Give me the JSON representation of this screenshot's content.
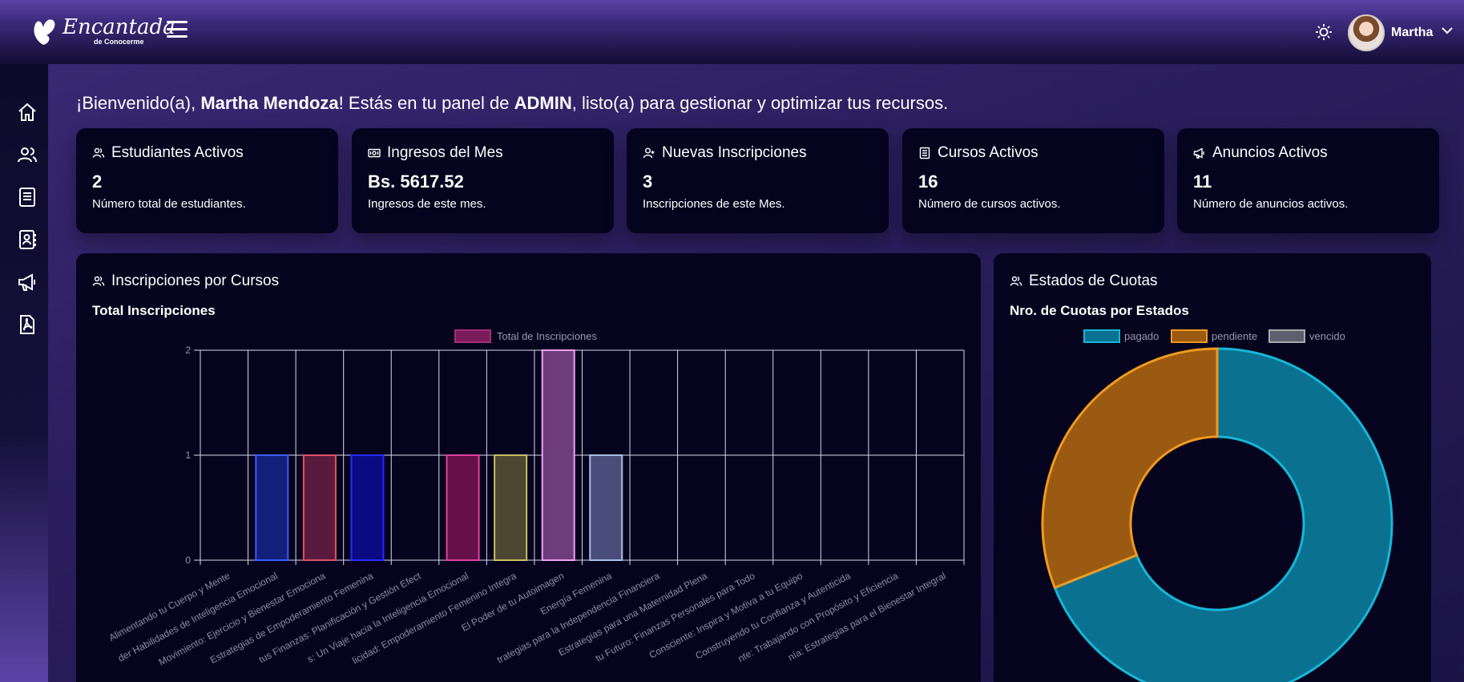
{
  "brand": {
    "name": "Encantada",
    "tagline": "de Conocerme"
  },
  "topbar": {
    "user_name": "Martha"
  },
  "sidebar": {
    "items": [
      {
        "icon": "home-icon"
      },
      {
        "icon": "users-icon"
      },
      {
        "icon": "book-icon"
      },
      {
        "icon": "contacts-icon"
      },
      {
        "icon": "megaphone-icon"
      },
      {
        "icon": "pdf-icon"
      }
    ]
  },
  "welcome": {
    "prefix": "¡Bienvenido(a), ",
    "name": "Martha Mendoza",
    "middle": "! Estás en tu panel de ",
    "role": "ADMIN",
    "suffix": ", listo(a) para gestionar y optimizar tus recursos."
  },
  "cards": [
    {
      "title": "Estudiantes Activos",
      "value": "2",
      "desc": "Número total de estudiantes.",
      "icon": "users-icon"
    },
    {
      "title": "Ingresos del Mes",
      "value": "Bs. 5617.52",
      "desc": "Ingresos de este mes.",
      "icon": "money-icon"
    },
    {
      "title": "Nuevas Inscripciones",
      "value": "3",
      "desc": "Inscripciones de este Mes.",
      "icon": "user-plus-icon"
    },
    {
      "title": "Cursos Activos",
      "value": "16",
      "desc": "Número de cursos activos.",
      "icon": "book-icon"
    },
    {
      "title": "Anuncios Activos",
      "value": "11",
      "desc": "Número de anuncios activos.",
      "icon": "megaphone-icon"
    }
  ],
  "bar_panel": {
    "title": "Inscripciones por Cursos",
    "subtitle": "Total Inscripciones"
  },
  "donut_panel": {
    "title": "Estados de Cuotas",
    "subtitle": "Nro. de Cuotas por Estados"
  },
  "chart_data": [
    {
      "type": "bar",
      "title": "Total Inscripciones",
      "ylim": [
        0,
        2
      ],
      "yticks": [
        0,
        1,
        2
      ],
      "grid": true,
      "legend_position": "top",
      "categories": [
        "Alimentando tu Cuerpo y Mente",
        "der Habilidades de Inteligencia Emocional",
        "Movimiento: Ejercicio y Bienestar Emociona",
        "Estrategias de Empoderamiento Femenina",
        "tus Finanzas: Planificación y Gestión Efect",
        "s: Un Viaje hacia la Inteligencia Emocional",
        "licidad: Empoderamiento Femenino Integra",
        "El Poder de tu Autoimagen",
        "Energía Femenina",
        "trategias para la Independencia Financiera",
        "Estrategias para una Maternidad Plena",
        "tu Futuro: Finanzas Personales para Todo",
        "Consciente: Inspira y Motiva a tu Equipo",
        "Construyendo tu Confianza y Autenticida",
        "nte: Trabajando con Propósito y Eficiencia",
        "nía: Estrategias para el Bienestar Integral"
      ],
      "series": [
        {
          "name": "Total de Inscripciones",
          "values": [
            0,
            1,
            1,
            1,
            0,
            1,
            1,
            2,
            1,
            0,
            0,
            0,
            0,
            0,
            0,
            0
          ]
        }
      ],
      "bar_colors": [
        "#3b5cff",
        "#3b5cff",
        "#e0506a",
        "#2a2aff",
        "#888888",
        "#e0409a",
        "#c8c060",
        "#f0a0f0",
        "#a8c0e8",
        "#888",
        "#888",
        "#888",
        "#888",
        "#888",
        "#888",
        "#888"
      ],
      "bar_fills": [
        "#13207a",
        "#13207a",
        "#5a1a3e",
        "#0a0a82",
        "#222",
        "#66104a",
        "#4c4632",
        "#6e3c7a",
        "#4a4c7a",
        "#222",
        "#222",
        "#222",
        "#222",
        "#222",
        "#222",
        "#222"
      ],
      "legend_color": "#7a1a5a"
    },
    {
      "type": "pie",
      "subtype": "doughnut",
      "title": "Nro. de Cuotas por Estados",
      "legend_position": "top",
      "labels": [
        "pagado",
        "pendiente",
        "vencido"
      ],
      "values": [
        69,
        31,
        0
      ],
      "colors": [
        "#0b7190",
        "#9a5a12",
        "#5e5e6e"
      ],
      "borders": [
        "#16b6d8",
        "#f09a20",
        "#aaaaaa"
      ]
    }
  ]
}
